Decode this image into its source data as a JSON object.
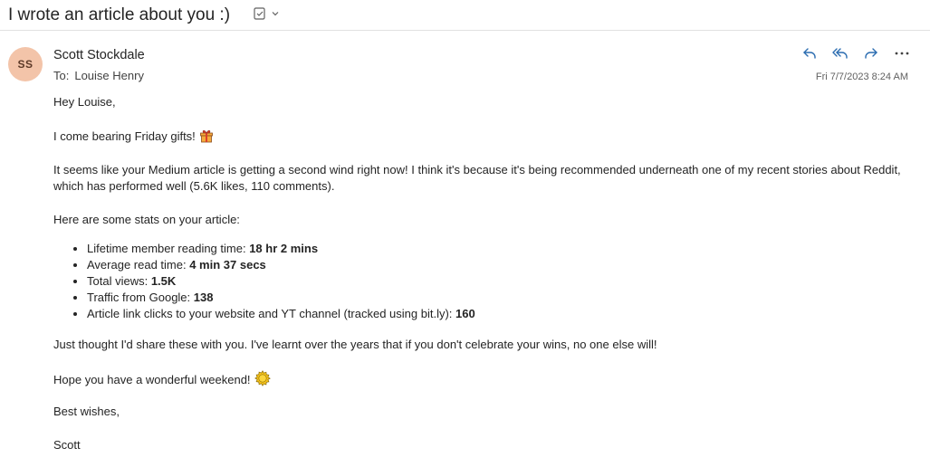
{
  "subject": "I wrote an article about you :)",
  "sender": {
    "initials": "SS",
    "name": "Scott Stockdale",
    "to_label": "To:",
    "to_name": "Louise Henry",
    "avatar_color": "#f3c4a9"
  },
  "timestamp": "Fri 7/7/2023 8:24 AM",
  "actions": [
    "reply-icon",
    "reply-all-icon",
    "forward-icon",
    "more-icon"
  ],
  "body": {
    "greeting": "Hey Louise,",
    "line1": "I come bearing Friday gifts!",
    "line1_emoji": "gift-icon",
    "line2": "It seems like your Medium article is getting a second wind right now! I think it's because it's being recommended underneath one of my recent stories about Reddit, which has performed well (5.6K likes, 110 comments).",
    "stats_intro": "Here are some stats on your article:",
    "stats": [
      {
        "label": "Lifetime member reading time: ",
        "value": "18 hr 2 mins"
      },
      {
        "label": "Average read time: ",
        "value": "4 min 37 secs"
      },
      {
        "label": "Total views: ",
        "value": "1.5K"
      },
      {
        "label": "Traffic from Google: ",
        "value": "138"
      },
      {
        "label": "Article link clicks to your website and YT channel (tracked using bit.ly): ",
        "value": "160"
      }
    ],
    "line3": "Just thought I'd share these with you. I've learnt over the years that if you don't celebrate your wins, no one else will!",
    "line4": "Hope you have a wonderful weekend!",
    "line4_emoji": "sun-icon",
    "signoff": "Best wishes,",
    "signature": "Scott"
  }
}
